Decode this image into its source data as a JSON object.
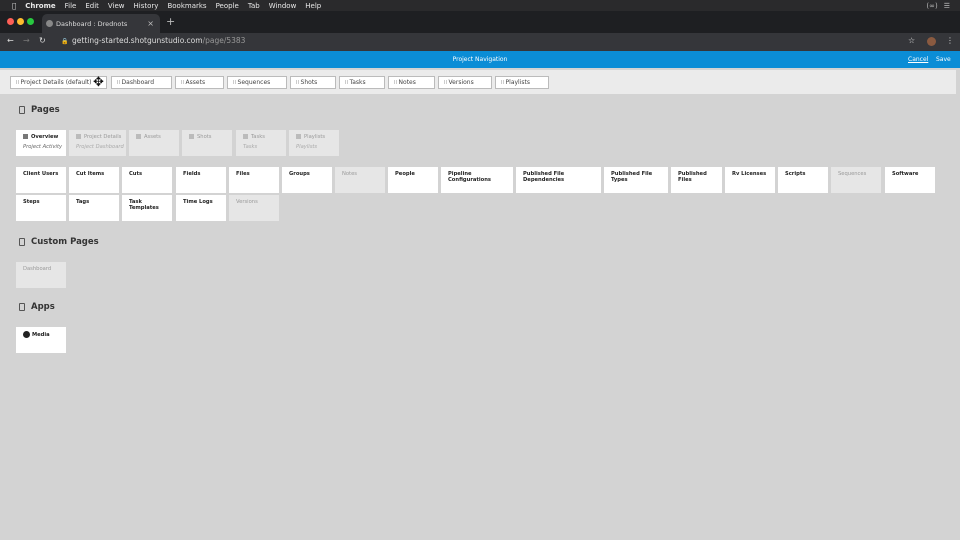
{
  "os_menu": {
    "app": "Chrome",
    "items": [
      "File",
      "Edit",
      "View",
      "History",
      "Bookmarks",
      "People",
      "Tab",
      "Window",
      "Help"
    ]
  },
  "browser": {
    "tab_title": "Dashboard : Drednots",
    "url_host": "getting-started.shotgunstudio.com",
    "url_path": "/page/5383"
  },
  "header": {
    "title": "Project Navigation",
    "cancel": "Cancel",
    "save": "Save"
  },
  "nav_tabs": [
    "Project Details (default)",
    "Dashboard",
    "Assets",
    "Sequences",
    "Shots",
    "Tasks",
    "Notes",
    "Versions",
    "Playlists"
  ],
  "sections": {
    "pages": "Pages",
    "custom_pages": "Custom Pages",
    "apps": "Apps"
  },
  "page_cards": [
    {
      "title": "Overview",
      "sub": "Project Activity",
      "disabled": false
    },
    {
      "title": "Project Details",
      "sub": "Project Dashboard",
      "disabled": true
    },
    {
      "title": "Assets",
      "sub": "",
      "disabled": true
    },
    {
      "title": "Shots",
      "sub": "",
      "disabled": true
    },
    {
      "title": "Tasks",
      "sub": "Tasks",
      "disabled": true
    },
    {
      "title": "Playlists",
      "sub": "Playlists",
      "disabled": true
    }
  ],
  "entity_cards": [
    {
      "title": "Client Users",
      "disabled": false
    },
    {
      "title": "Cut Items",
      "disabled": false
    },
    {
      "title": "Cuts",
      "disabled": false
    },
    {
      "title": "Fields",
      "disabled": false
    },
    {
      "title": "Files",
      "disabled": false
    },
    {
      "title": "Groups",
      "disabled": false
    },
    {
      "title": "Notes",
      "disabled": true
    },
    {
      "title": "People",
      "disabled": false
    },
    {
      "title": "Pipeline Configurations",
      "disabled": false
    },
    {
      "title": "Published File Dependencies",
      "disabled": false
    },
    {
      "title": "Published File Types",
      "disabled": false
    },
    {
      "title": "Published Files",
      "disabled": false
    },
    {
      "title": "Rv Licenses",
      "disabled": false
    },
    {
      "title": "Scripts",
      "disabled": false
    },
    {
      "title": "Sequences",
      "disabled": true
    },
    {
      "title": "Software",
      "disabled": false
    },
    {
      "title": "Steps",
      "disabled": false
    },
    {
      "title": "Tags",
      "disabled": false
    },
    {
      "title": "Task Templates",
      "disabled": false
    },
    {
      "title": "Time Logs",
      "disabled": false
    },
    {
      "title": "Versions",
      "disabled": true
    }
  ],
  "custom_cards": [
    {
      "title": "Dashboard",
      "disabled": true
    }
  ],
  "app_cards": [
    {
      "title": "Media",
      "icon": "play-icon"
    }
  ]
}
